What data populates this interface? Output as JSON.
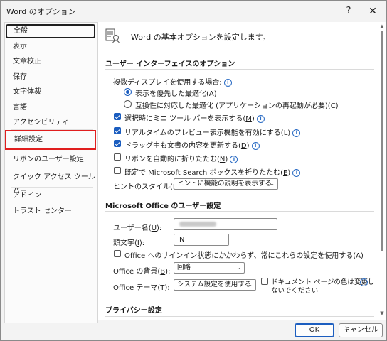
{
  "window": {
    "title": "Word のオプション",
    "help_label": "?",
    "close_label": "✕"
  },
  "sidebar": {
    "items": [
      {
        "label": "全般",
        "state": "selected"
      },
      {
        "label": "表示"
      },
      {
        "label": "文章校正"
      },
      {
        "label": "保存"
      },
      {
        "label": "文字体裁"
      },
      {
        "label": "言語"
      },
      {
        "label": "アクセシビリティ"
      },
      {
        "label": "詳細設定",
        "state": "highlighted"
      },
      {
        "label": "リボンのユーザー設定"
      },
      {
        "label": "クイック アクセス ツール バー"
      },
      {
        "label": "アドイン"
      },
      {
        "label": "トラスト センター"
      }
    ]
  },
  "main": {
    "header": "Word の基本オプションを設定します。",
    "ui_section": {
      "title": "ユーザー インターフェイスのオプション",
      "multi_display_label": "複数ディスプレイを使用する場合:",
      "radio_optimize_display": {
        "text": "表示を優先した最適化(",
        "key": "A",
        "end": ")",
        "checked": true
      },
      "radio_optimize_compat": {
        "text": "互換性に対応した最適化 (アプリケーションの再起動が必要)(",
        "key": "C",
        "end": ")",
        "checked": false
      },
      "checkboxes": [
        {
          "text": "選択時にミニ ツール バーを表示する(",
          "key": "M",
          "end": ")",
          "checked": true,
          "info": true
        },
        {
          "text": "リアルタイムのプレビュー表示機能を有効にする(",
          "key": "L",
          "end": ")",
          "checked": true,
          "info": true
        },
        {
          "text": "ドラッグ中も文書の内容を更新する(",
          "key": "D",
          "end": ")",
          "checked": true,
          "info": true
        },
        {
          "text": "リボンを自動的に折りたたむ(",
          "key": "N",
          "end": ")",
          "checked": false,
          "info": true
        },
        {
          "text": "既定で Microsoft Search ボックスを折りたたむ(",
          "key": "E",
          "end": ")",
          "checked": false,
          "info": true
        }
      ],
      "tooltip_style_label_a": "ヒントのスタイル(",
      "tooltip_style_key": "R",
      "tooltip_style_label_b": "):",
      "tooltip_style_value": "ヒントに機能の説明を表示する"
    },
    "personalize_section": {
      "title": "Microsoft Office のユーザー設定",
      "username_label_a": "ユーザー名(",
      "username_key": "U",
      "username_label_b": "):",
      "initials_label_a": "頭文字(",
      "initials_key": "I",
      "initials_label_b": "):",
      "initials_value": "N",
      "signin_checkbox": {
        "text": "Office へのサインイン状態にかかわらず、常にこれらの設定を使用する(",
        "key": "A",
        "end": ")",
        "checked": false
      },
      "background_label_a": "Office の背景(",
      "background_key": "B",
      "background_label_b": "):",
      "background_value": "回路",
      "theme_label_a": "Office テーマ(",
      "theme_key": "T",
      "theme_label_b": "):",
      "theme_value": "システム設定を使用する",
      "no_change_page_color_line1": "ドキュメント ページの色は変更し",
      "no_change_page_color_line2": "ないでください",
      "no_change_page_color_checked": false
    },
    "privacy_section": {
      "title": "プライバシー設定"
    }
  },
  "footer": {
    "ok_label": "OK",
    "cancel_label": "キャンセル"
  },
  "colors": {
    "accent": "#1b5dbf",
    "highlight_box": "#e01e1e"
  }
}
